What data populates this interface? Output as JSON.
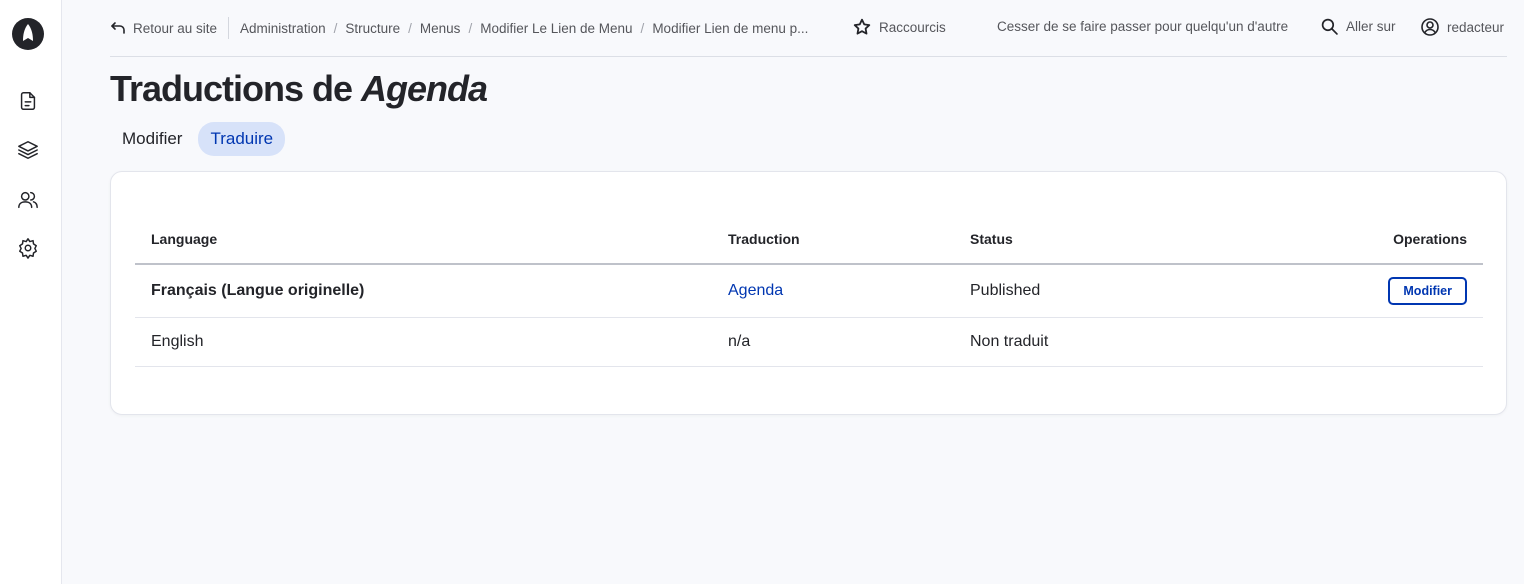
{
  "topbar": {
    "back_label": "Retour au site",
    "breadcrumbs": [
      "Administration",
      "Structure",
      "Menus",
      "Modifier Le Lien de Menu",
      "Modifier Lien de menu p..."
    ],
    "shortcuts_label": "Raccourcis",
    "stop_impersonate_label": "Cesser de se faire passer pour quelqu'un d'autre",
    "goto_label": "Aller sur",
    "user_label": "redacteur"
  },
  "page": {
    "title_prefix": "Traductions de ",
    "title_emph": "Agenda"
  },
  "tabs": [
    {
      "label": "Modifier",
      "active": false
    },
    {
      "label": "Traduire",
      "active": true
    }
  ],
  "table": {
    "headers": [
      "Language",
      "Traduction",
      "Status",
      "Operations"
    ],
    "rows": [
      {
        "language": "Français (Langue originelle)",
        "translation": "Agenda",
        "status": "Published",
        "operation": "Modifier"
      },
      {
        "language": "English",
        "translation": "n/a",
        "status": "Non traduit",
        "operation": ""
      }
    ]
  },
  "icons": {
    "sidebar": [
      "content-icon",
      "structure-icon",
      "people-icon",
      "config-icon"
    ]
  },
  "colors": {
    "accent": "#0036b1",
    "active_tab_bg": "#d7e2f9",
    "background": "#f8f9fc"
  }
}
